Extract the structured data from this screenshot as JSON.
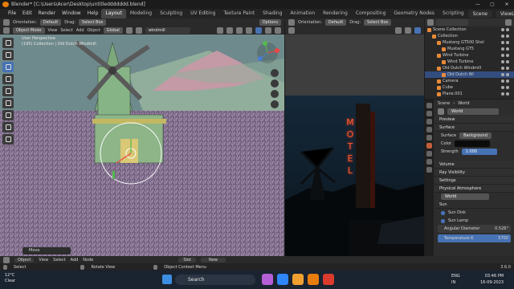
{
  "window": {
    "title": "Blender* [C:\\Users\\Acer\\Desktop\\untitleddddddd.blend]",
    "controls": [
      "—",
      "▢",
      "✕"
    ]
  },
  "menubar": {
    "menus": [
      "File",
      "Edit",
      "Render",
      "Window",
      "Help"
    ],
    "workspaces": [
      "Layout",
      "Modeling",
      "Sculpting",
      "UV Editing",
      "Texture Paint",
      "Shading",
      "Animation",
      "Rendering",
      "Compositing",
      "Geometry Nodes",
      "Scripting"
    ],
    "active_workspace": "Layout",
    "scene": "Scene",
    "view_layer": "ViewLayer"
  },
  "viewport": {
    "header": {
      "orientation_label": "Orientation:",
      "orientation": "Default",
      "drag_label": "Drag:",
      "drag": "Select Box",
      "mode": "Object Mode",
      "menus": [
        "View",
        "Select",
        "Add",
        "Object"
      ],
      "transform": "Global",
      "search": "windmill",
      "options": "Options"
    },
    "info_line1": "User Perspective",
    "info_line2": "(195) Collection | Old Dutch Windmill",
    "operator_panel": "Move"
  },
  "render_view": {
    "header": {
      "orientation_label": "Orientation:",
      "orientation": "Default",
      "drag_label": "Drag:",
      "drag": "Select Box"
    },
    "sign_letters": [
      "M",
      "O",
      "T",
      "E",
      "L"
    ]
  },
  "outliner": {
    "rows": [
      {
        "label": "Scene Collection",
        "indent": 0,
        "selected": false
      },
      {
        "label": "Collection",
        "indent": 1,
        "selected": false
      },
      {
        "label": "Mustang GT500 Shel",
        "indent": 2,
        "selected": false
      },
      {
        "label": "Mustang GT5",
        "indent": 3,
        "selected": false
      },
      {
        "label": "Wind Turbine",
        "indent": 2,
        "selected": false
      },
      {
        "label": "Wind Turbine",
        "indent": 3,
        "selected": false
      },
      {
        "label": "Old Dutch Windmill",
        "indent": 2,
        "selected": false
      },
      {
        "label": "Old Dutch Wi",
        "indent": 3,
        "selected": true
      },
      {
        "label": "Camera",
        "indent": 2,
        "selected": false
      },
      {
        "label": "Cube",
        "indent": 2,
        "selected": false
      },
      {
        "label": "Plane.001",
        "indent": 2,
        "selected": false
      }
    ]
  },
  "properties": {
    "breadcrumb_scene": "Scene",
    "breadcrumb_world": "World",
    "world_name": "World",
    "sections": {
      "preview": "Preview",
      "surface": "Surface",
      "volume": "Volume",
      "ray_visibility": "Ray Visibility",
      "settings": "Settings",
      "physical_atmosphere": "Physical Atmosphere",
      "sun": "Sun"
    },
    "surface_label": "Surface",
    "surface_value": "Background",
    "color_label": "Color",
    "strength_label": "Strength",
    "strength_value": "1.000",
    "atmo_world": "World",
    "sun_disk": "Sun Disk",
    "sun_lamp": "Sun Lamp",
    "angular_diameter_label": "Angular Diameter",
    "angular_diameter_value": "0.526°",
    "temperature_label": "Temperature K",
    "temperature_value": "5700"
  },
  "statusbar": {
    "obj_mode": "Object",
    "menus": [
      "View",
      "Select",
      "Add",
      "Node"
    ],
    "slot": "Slot",
    "new": "New",
    "hints": [
      "Select",
      "Rotate View",
      "Object Context Menu"
    ],
    "version": "3.6.0"
  },
  "taskbar": {
    "temperature": "12°C",
    "condition": "Clear",
    "search": "Search",
    "lang": "ENG",
    "region": "IN",
    "time": "03:46 PM",
    "date": "16-09-2023"
  },
  "colors": {
    "accent": "#4772b3",
    "blender_orange": "#e87d0d",
    "motel_red": "#e63b1e"
  }
}
